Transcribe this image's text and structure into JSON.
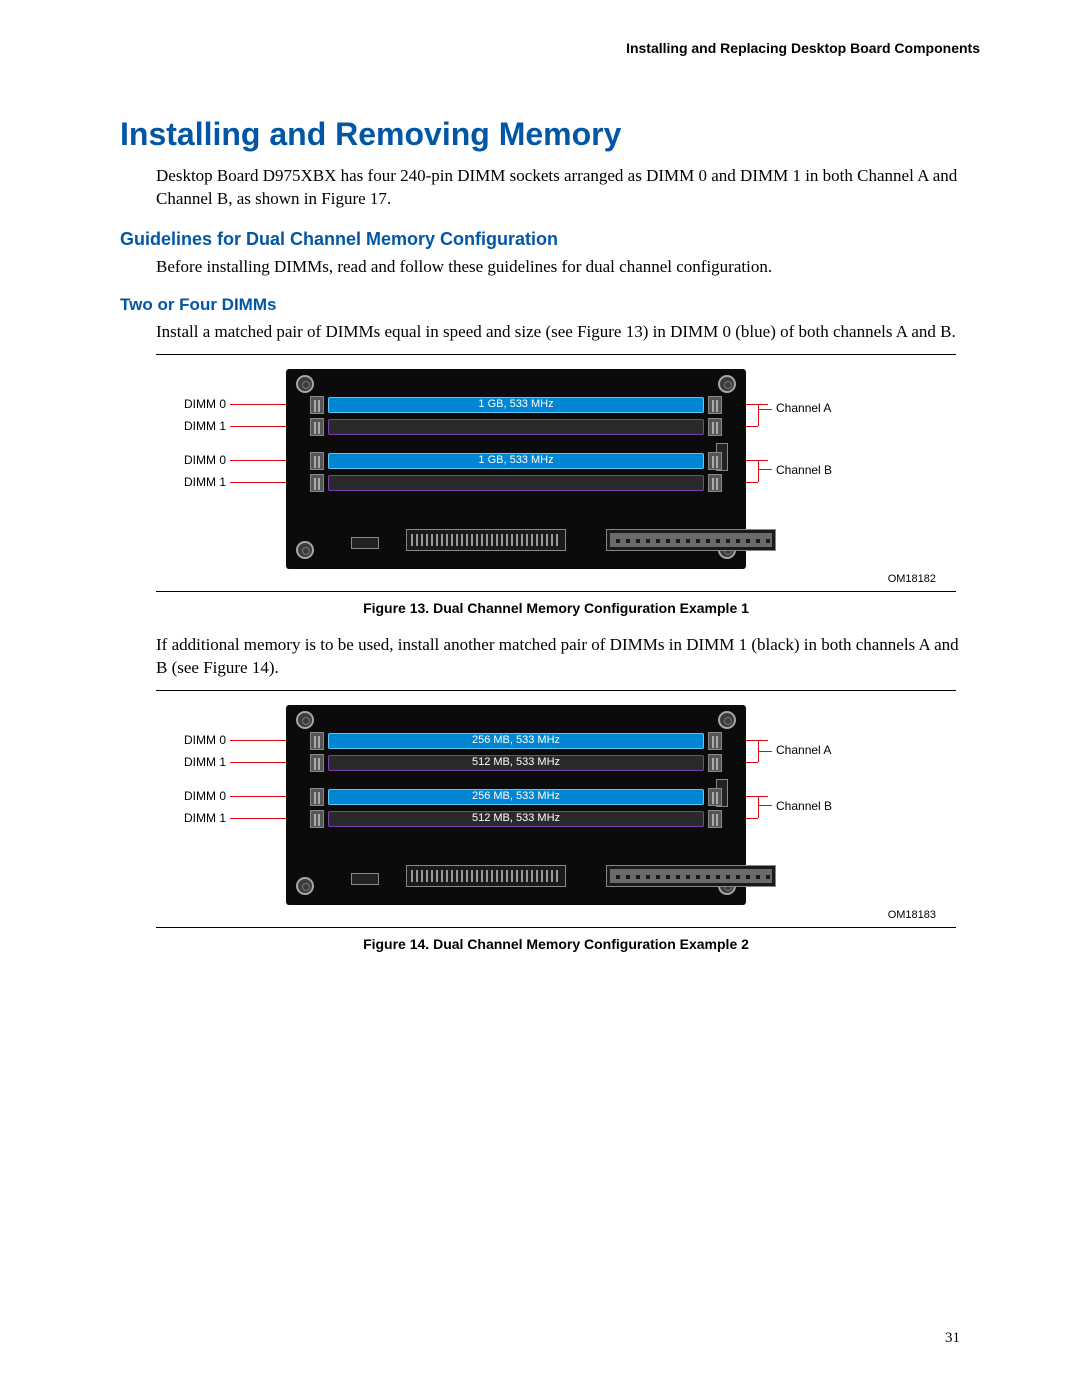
{
  "header": "Installing and Replacing Desktop Board Components",
  "title": "Installing and Removing Memory",
  "intro": "Desktop Board D975XBX has four 240-pin DIMM sockets arranged as DIMM 0 and DIMM 1 in both Channel A and Channel B, as shown in Figure 17.",
  "h2": "Guidelines for Dual Channel Memory Configuration",
  "p2": "Before installing DIMMs, read and follow these guidelines for dual channel configuration.",
  "h3": "Two or Four DIMMs",
  "p3": "Install a matched pair of DIMMs equal in speed and size (see Figure 13) in DIMM 0 (blue) of both channels A and B.",
  "p4": "If additional memory is to be used, install another matched pair of DIMMs in DIMM 1 (black) in both channels A and B (see Figure 14).",
  "fig13": {
    "dimm_left": [
      "DIMM 0",
      "DIMM 1",
      "DIMM 0",
      "DIMM 1"
    ],
    "channel_right": [
      "Channel A",
      "Channel B"
    ],
    "slot_text": [
      "1 GB, 533 MHz",
      "",
      "1 GB, 533 MHz",
      ""
    ],
    "om": "OM18182",
    "caption": "Figure 13.  Dual Channel Memory Configuration Example 1"
  },
  "fig14": {
    "dimm_left": [
      "DIMM 0",
      "DIMM 1",
      "DIMM 0",
      "DIMM 1"
    ],
    "channel_right": [
      "Channel A",
      "Channel B"
    ],
    "slot_text": [
      "256 MB, 533 MHz",
      "512 MB, 533 MHz",
      "256 MB, 533 MHz",
      "512 MB, 533 MHz"
    ],
    "om": "OM18183",
    "caption": "Figure 14.  Dual Channel Memory Configuration Example 2"
  },
  "page_number": "31"
}
